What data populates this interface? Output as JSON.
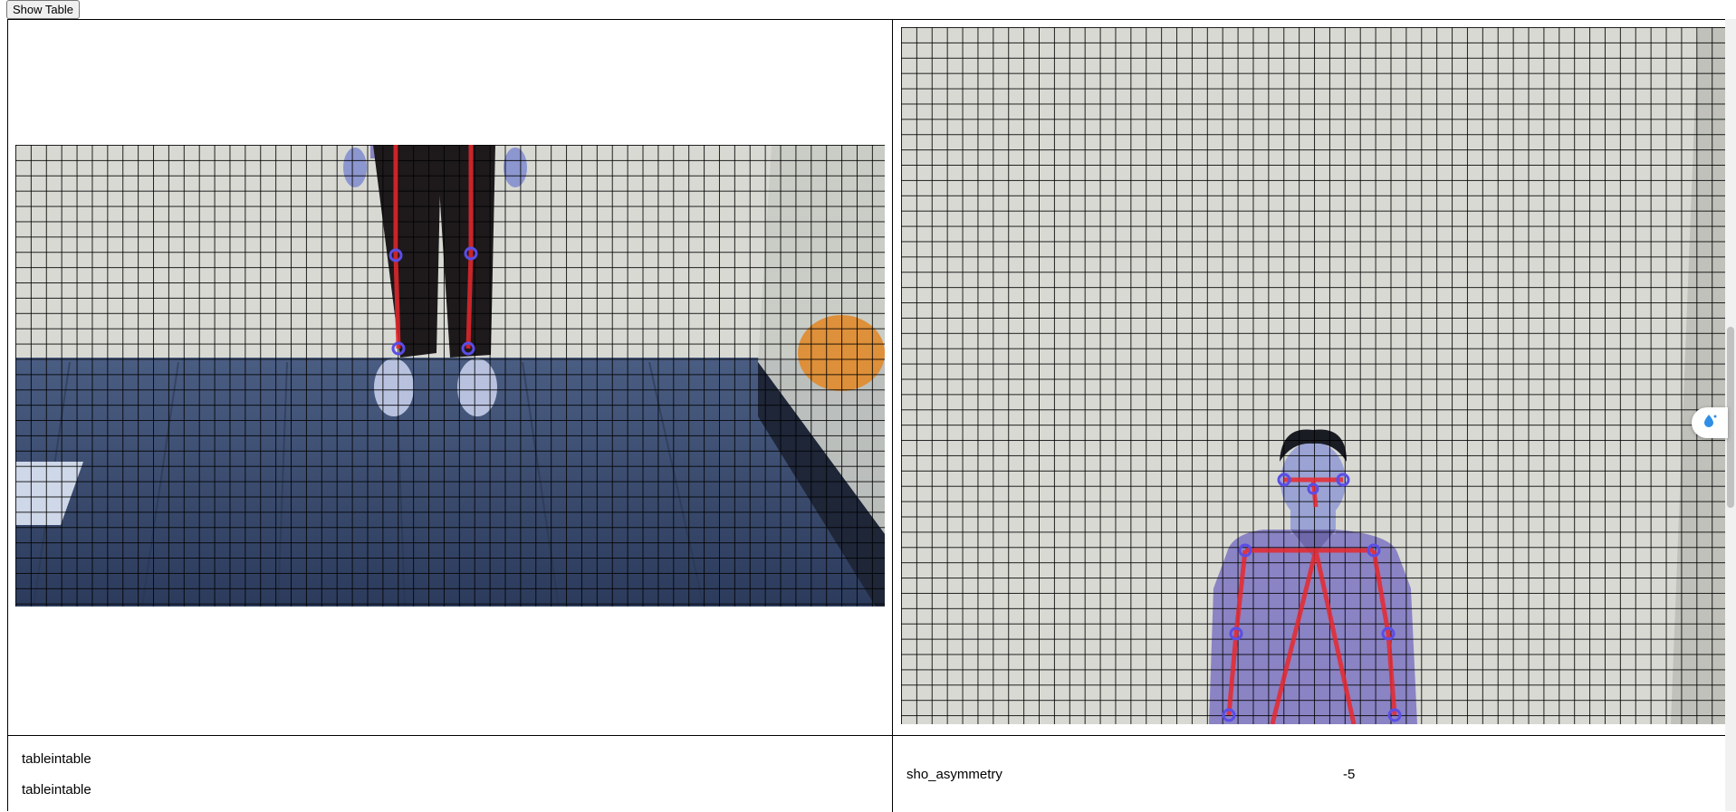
{
  "toolbar": {
    "show_table_label": "Show Table"
  },
  "results": {
    "left_rows": [
      "tableintable",
      "tableintable"
    ],
    "right_row": {
      "label": "sho_asymmetry",
      "value": "-5"
    }
  },
  "photos": {
    "left": {
      "view": "front view, lower body",
      "keypoints": [
        "left-knee",
        "right-knee",
        "left-ankle",
        "right-ankle"
      ]
    },
    "right": {
      "view": "front view, upper body",
      "keypoints": [
        "eyes",
        "nose",
        "left-shoulder",
        "right-shoulder",
        "left-elbow",
        "right-elbow",
        "left-wrist",
        "right-wrist"
      ]
    }
  },
  "colors": {
    "skeleton": "#e8282d",
    "keypoint": "#5b4de6",
    "grid_line": "#000000",
    "wall": "#d8d9d3",
    "floor": "#3d4f73"
  },
  "icons": [
    "water-drop-icon"
  ]
}
